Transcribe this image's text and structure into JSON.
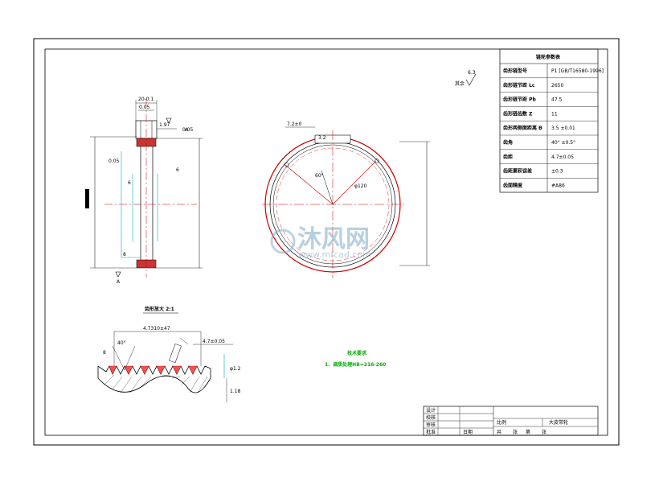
{
  "drawing": {
    "surface_roughness_symbol": "6.3",
    "surface_roughness_label": "其余",
    "detail_view_title": "齿形放大 2:1",
    "technical_requirements": {
      "title": "技术要求",
      "items": [
        "1、调质处理HB=216-260"
      ]
    },
    "watermark": {
      "brand": "沐风网",
      "url": "www.mfcad.com"
    }
  },
  "params_table": {
    "title": "链轮参数表",
    "rows": [
      {
        "label": "齿形链型号",
        "value": "P1 [GB/T16580-1996]"
      },
      {
        "label": "齿形链节距 Lc",
        "value": "2650"
      },
      {
        "label": "齿形链节距 Pb",
        "value": "47.5"
      },
      {
        "label": "齿形链齿数 Z",
        "value": "11"
      },
      {
        "label": "齿形两侧面距离 B",
        "value": "3.5 ±0.01"
      },
      {
        "label": "齿角",
        "value": "40° ±0.5°"
      },
      {
        "label": "齿距",
        "value": "4.7±0.05"
      },
      {
        "label": "齿距累积误差",
        "value": "±0.3"
      },
      {
        "label": "齿面精度",
        "value": "#A86"
      }
    ]
  },
  "title_block": {
    "rows": [
      "设计",
      "校核",
      "审核",
      "批准"
    ],
    "sign_label": "日期",
    "scale_label": "比例",
    "part_name": "大皮带轮",
    "sheet_labels": [
      "共",
      "张",
      "第",
      "张"
    ]
  },
  "dimensions": {
    "side_view": [
      "20-0.1",
      "0.05",
      "1.97",
      "0.05",
      "0.05",
      "6",
      "6",
      "8",
      "A",
      "A"
    ],
    "front_view": [
      "7.2±0",
      "3.2",
      "60°",
      "φ120"
    ],
    "detail_view": [
      "4.7310±47",
      "4.7±0.05",
      "40°",
      "φ1.2",
      "8",
      "1.18"
    ]
  }
}
